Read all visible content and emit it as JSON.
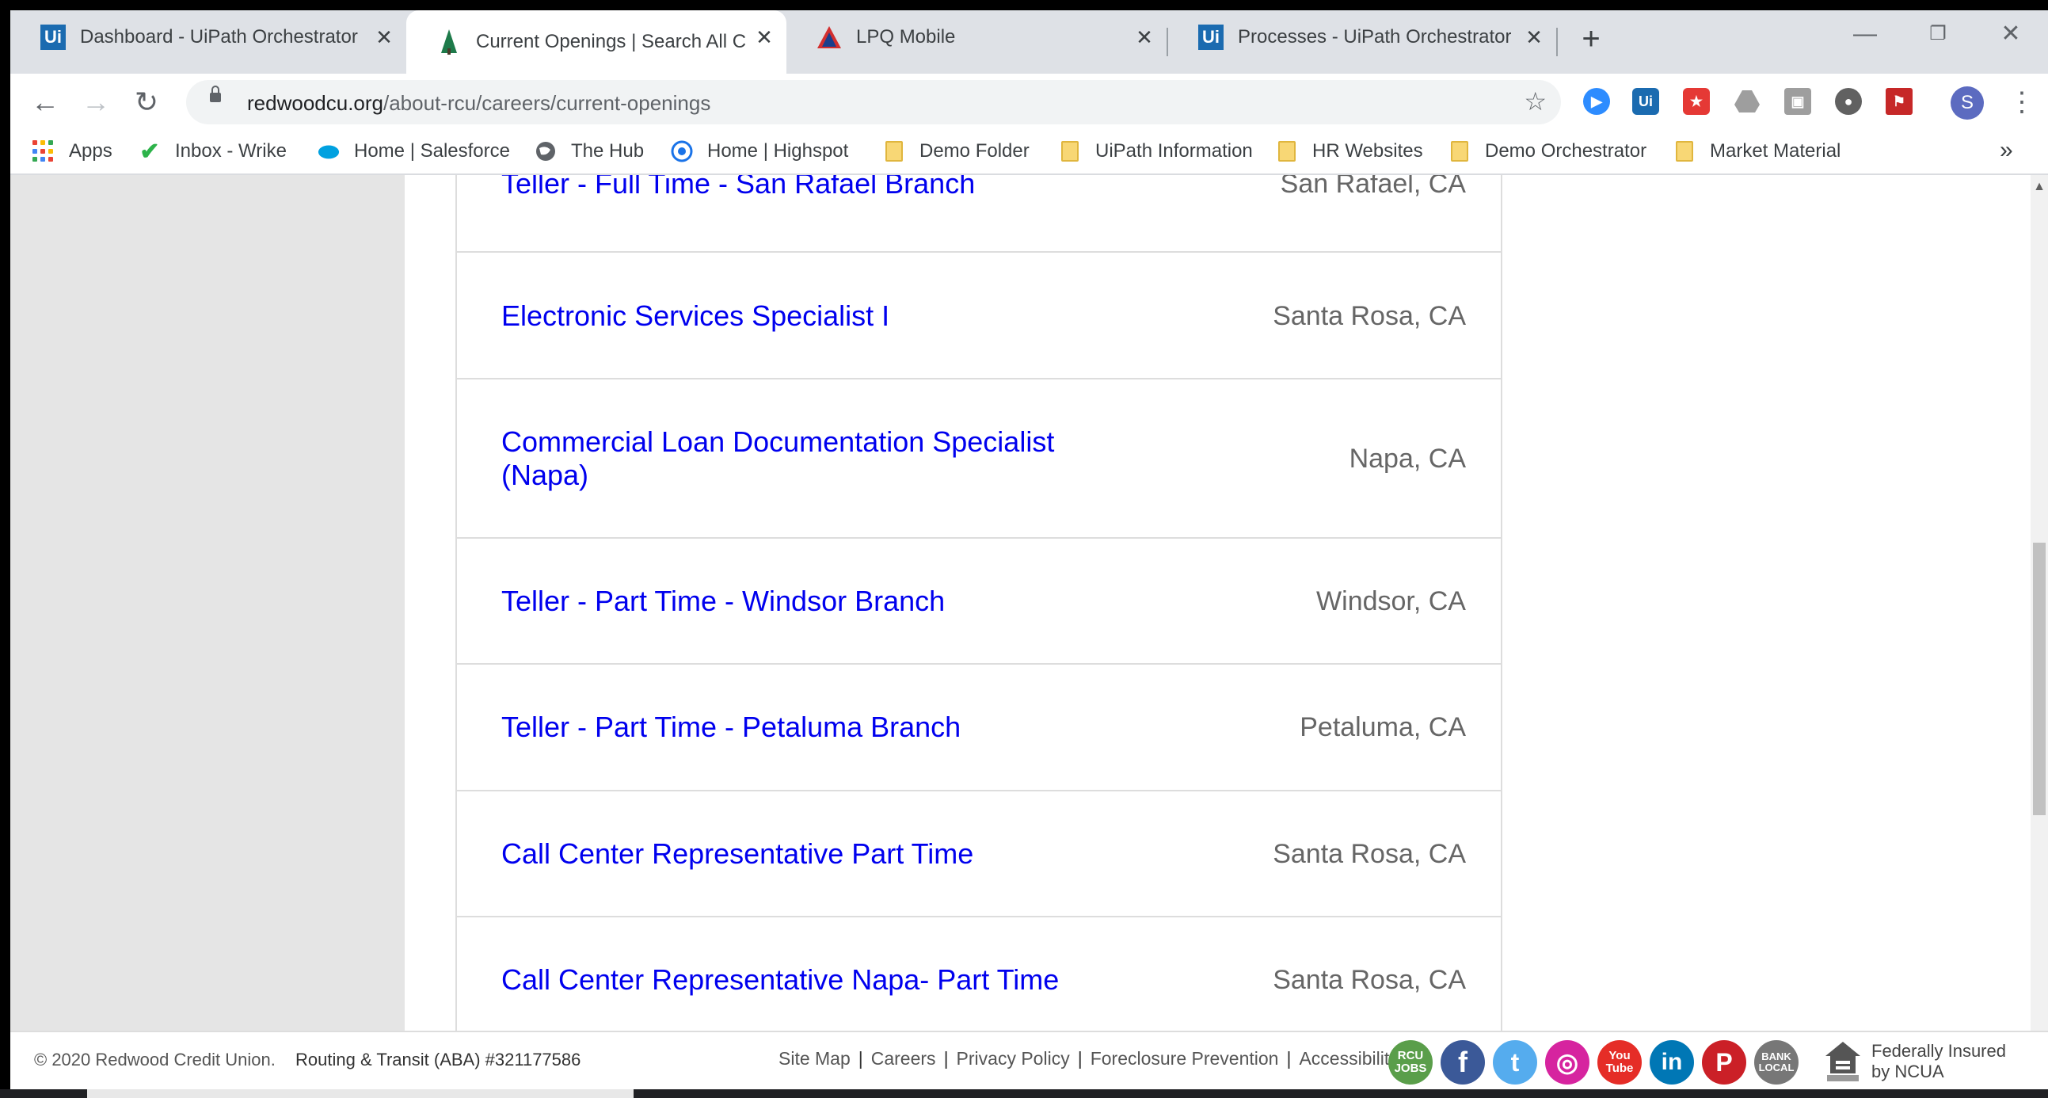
{
  "tabs": [
    {
      "title": "Dashboard - UiPath Orchestrator",
      "icon": "uipath-icon"
    },
    {
      "title": "Current Openings | Search All Cu",
      "icon": "redwood-tree-icon"
    },
    {
      "title": "LPQ Mobile",
      "icon": "lpq-icon"
    },
    {
      "title": "Processes - UiPath Orchestrator",
      "icon": "uipath-icon"
    }
  ],
  "address": {
    "domain": "redwoodcu.org",
    "path": "/about-rcu/careers/current-openings"
  },
  "profile_initial": "S",
  "bookmarks": [
    {
      "label": "Apps"
    },
    {
      "label": "Inbox - Wrike"
    },
    {
      "label": "Home | Salesforce"
    },
    {
      "label": "The Hub"
    },
    {
      "label": "Home | Highspot"
    },
    {
      "label": "Demo Folder"
    },
    {
      "label": "UiPath Information"
    },
    {
      "label": "HR Websites"
    },
    {
      "label": "Demo Orchestrator"
    },
    {
      "label": "Market Material"
    }
  ],
  "jobs": [
    {
      "title": "Teller - Full Time - San Rafael Branch",
      "location": "San Rafael, CA"
    },
    {
      "title": "Electronic Services Specialist I",
      "location": "Santa Rosa, CA"
    },
    {
      "title": "Commercial Loan Documentation Specialist (Napa)",
      "location": "Napa, CA"
    },
    {
      "title": "Teller - Part Time - Windsor Branch",
      "location": "Windsor, CA"
    },
    {
      "title": "Teller - Part Time - Petaluma Branch",
      "location": "Petaluma, CA"
    },
    {
      "title": "Call Center Representative Part Time",
      "location": "Santa Rosa, CA"
    },
    {
      "title": "Call Center Representative Napa- Part Time",
      "location": "Santa Rosa, CA"
    }
  ],
  "footer": {
    "copyright": "© 2020 Redwood Credit Union.",
    "routing": "Routing & Transit (ABA) #321177586",
    "links": [
      "Site Map",
      "Careers",
      "Privacy Policy",
      "Foreclosure Prevention",
      "Accessibility"
    ],
    "social": [
      {
        "name": "rcu-jobs-icon",
        "text": "RCU JOBS",
        "color": "#5a9e4a"
      },
      {
        "name": "facebook-icon",
        "text": "f",
        "color": "#3b5998"
      },
      {
        "name": "twitter-icon",
        "text": "t",
        "color": "#55acee"
      },
      {
        "name": "instagram-icon",
        "text": "◎",
        "color": "#d6249f"
      },
      {
        "name": "youtube-icon",
        "text": "You Tube",
        "color": "#e52d27"
      },
      {
        "name": "linkedin-icon",
        "text": "in",
        "color": "#0077b5"
      },
      {
        "name": "pinterest-icon",
        "text": "P",
        "color": "#cb2027"
      },
      {
        "name": "bank-local-icon",
        "text": "BANK LOCAL",
        "color": "#777777"
      }
    ],
    "ncua_line1": "Federally Insured",
    "ncua_line2": "by NCUA"
  }
}
